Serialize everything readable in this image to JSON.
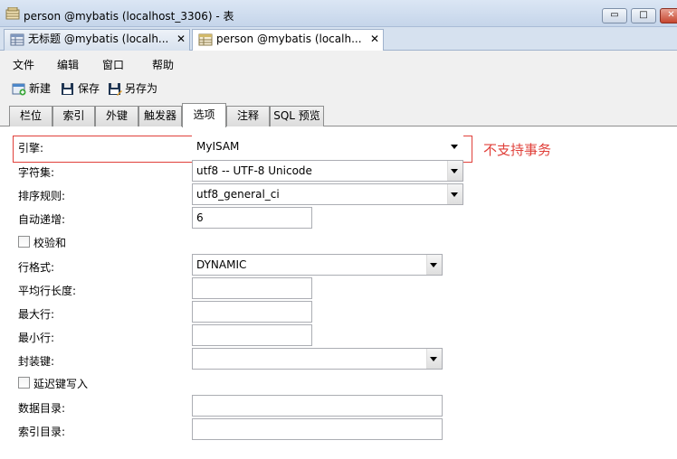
{
  "window": {
    "title": "person @mybatis (localhost_3306) - 表",
    "controls": {
      "minimize": "▭",
      "maximize": "□",
      "close": "✕"
    }
  },
  "doc_tabs": [
    {
      "label": "无标题 @mybatis (localh...",
      "close": "✕",
      "active": false
    },
    {
      "label": "person @mybatis (localh...",
      "close": "✕",
      "active": true
    }
  ],
  "menu": [
    "文件",
    "编辑",
    "窗口",
    "帮助"
  ],
  "toolbar": {
    "new_label": "新建",
    "save_label": "保存",
    "save_as_label": "另存为"
  },
  "prop_tabs": [
    "栏位",
    "索引",
    "外键",
    "触发器",
    "选项",
    "注释",
    "SQL 预览"
  ],
  "active_prop_tab": "选项",
  "form": {
    "engine": {
      "label": "引擎:",
      "value": "MyISAM"
    },
    "charset": {
      "label": "字符集:",
      "value": "utf8 -- UTF-8 Unicode"
    },
    "collation": {
      "label": "排序规则:",
      "value": "utf8_general_ci"
    },
    "auto_increment": {
      "label": "自动递增:",
      "value": "6"
    },
    "checksum": {
      "label": "校验和",
      "checked": false
    },
    "row_format": {
      "label": "行格式:",
      "value": "DYNAMIC"
    },
    "avg_row_length": {
      "label": "平均行长度:",
      "value": ""
    },
    "max_rows": {
      "label": "最大行:",
      "value": ""
    },
    "min_rows": {
      "label": "最小行:",
      "value": ""
    },
    "pack_keys": {
      "label": "封装键:",
      "value": ""
    },
    "delay_key_write": {
      "label": "延迟键写入",
      "checked": false
    },
    "data_directory": {
      "label": "数据目录:",
      "value": ""
    },
    "index_directory": {
      "label": "索引目录:",
      "value": ""
    }
  },
  "annotation": {
    "note": "不支持事务",
    "color": "#e0403a"
  },
  "colors": {
    "titlebar": "#c5d5ea",
    "highlight": "#e0403a"
  }
}
